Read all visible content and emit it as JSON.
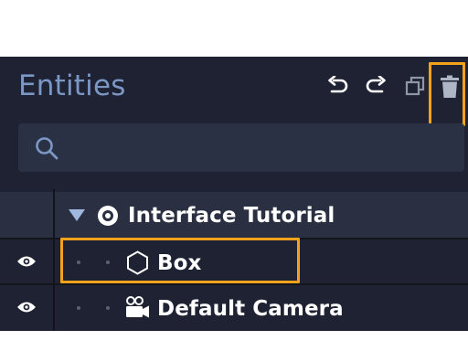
{
  "panel": {
    "title": "Entities",
    "toolbar": {
      "undo_icon": "undo-icon",
      "redo_icon": "redo-icon",
      "duplicate_icon": "duplicate-icon",
      "delete_icon": "trash-icon"
    },
    "search": {
      "placeholder": "",
      "value": "",
      "icon": "search-icon"
    }
  },
  "tree": {
    "root": {
      "label": "Interface Tutorial",
      "icon": "scene-icon",
      "expanded": true
    },
    "items": [
      {
        "label": "Box",
        "icon": "hexagon-icon",
        "visible": true
      },
      {
        "label": "Default Camera",
        "icon": "camera-icon",
        "visible": true
      }
    ]
  },
  "colors": {
    "panel_bg": "#1e2233",
    "header_row_bg": "#2a3042",
    "title": "#7b97c4",
    "highlight": "#f3a21b",
    "icon": "#ffffff"
  }
}
